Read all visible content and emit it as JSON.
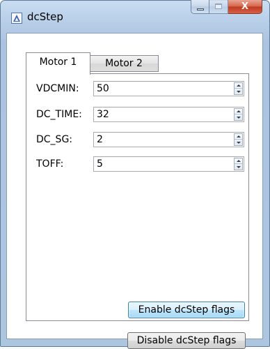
{
  "window": {
    "title": "dcStep",
    "close_glyph": "X",
    "min_glyph": "",
    "max_glyph": ""
  },
  "tabs": [
    {
      "label": "Motor 1",
      "selected": true
    },
    {
      "label": "Motor 2",
      "selected": false
    }
  ],
  "fields": [
    {
      "label": "VDCMIN:",
      "value": "50"
    },
    {
      "label": "DC_TIME:",
      "value": "32"
    },
    {
      "label": "DC_SG:",
      "value": "2"
    },
    {
      "label": "TOFF:",
      "value": "5"
    }
  ],
  "buttons": {
    "enable_label": "Enable dcStep flags",
    "disable_label": "Disable dcStep flags"
  },
  "colors": {
    "frame": "#b8cfe8",
    "close_button": "#c2391c",
    "primary_button": "#bee6fd"
  }
}
